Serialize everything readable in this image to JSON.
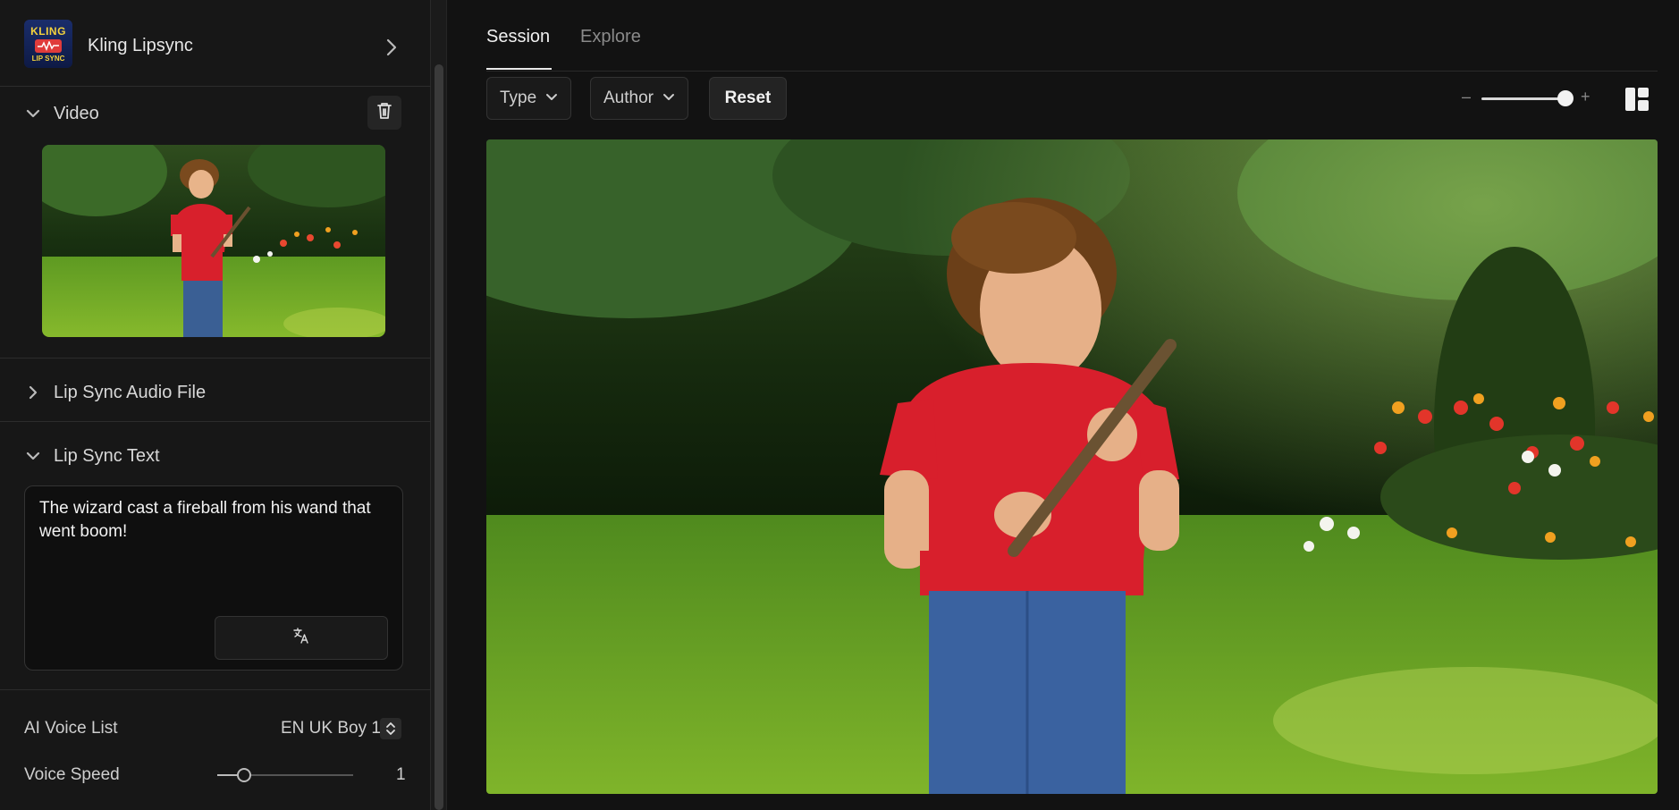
{
  "model": {
    "logo_top": "KLING",
    "logo_bottom": "LIP SYNC",
    "name": "Kling Lipsync"
  },
  "sections": {
    "video": "Video",
    "audio": "Lip Sync Audio File",
    "text": "Lip Sync Text"
  },
  "lip_sync_text": "The wizard cast a fireball from his wand that went boom!",
  "params": {
    "voice_list_label": "AI Voice List",
    "voice_list_value": "EN UK Boy 1",
    "voice_speed_label": "Voice Speed",
    "voice_speed_value": "1"
  },
  "tabs": {
    "session": "Session",
    "explore": "Explore"
  },
  "filters": {
    "type": "Type",
    "author": "Author",
    "reset": "Reset"
  },
  "zoom": {
    "minus": "–",
    "plus": "+",
    "level": 0.9
  },
  "colors": {
    "background": "#121212",
    "panel": "#171717",
    "accent_red_logo": "#e03b3b",
    "logo_yellow": "#f4d23c"
  }
}
